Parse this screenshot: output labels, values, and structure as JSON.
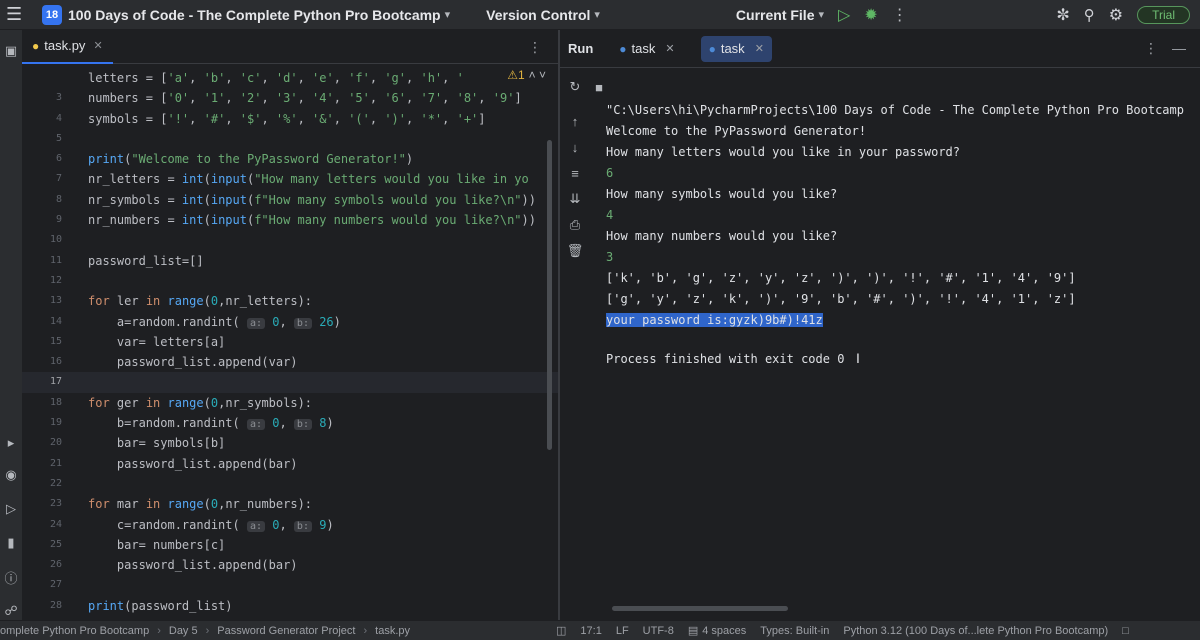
{
  "titlebar": {
    "project_badge": "18",
    "project_name": "100 Days of Code - The Complete Python Pro Bootcamp",
    "vcs_label": "Version Control",
    "run_config": "Current File",
    "trial_label": "Trial"
  },
  "editor": {
    "tab_label": "task.py",
    "warning_count": "1",
    "lines": [
      {
        "n": "",
        "html": "letters = [<span class=\"str\">'a'</span>, <span class=\"str\">'b'</span>, <span class=\"str\">'c'</span>, <span class=\"str\">'d'</span>, <span class=\"str\">'e'</span>, <span class=\"str\">'f'</span>, <span class=\"str\">'g'</span>, <span class=\"str\">'h'</span>, <span class=\"str\">'</span>"
      },
      {
        "n": "3",
        "html": "numbers = [<span class=\"str\">'0'</span>, <span class=\"str\">'1'</span>, <span class=\"str\">'2'</span>, <span class=\"str\">'3'</span>, <span class=\"str\">'4'</span>, <span class=\"str\">'5'</span>, <span class=\"str\">'6'</span>, <span class=\"str\">'7'</span>, <span class=\"str\">'8'</span>, <span class=\"str\">'9'</span>]"
      },
      {
        "n": "4",
        "html": "symbols = [<span class=\"str\">'!'</span>, <span class=\"str\">'#'</span>, <span class=\"str\">'$'</span>, <span class=\"str\">'%'</span>, <span class=\"str\">'&amp;'</span>, <span class=\"str\">'('</span>, <span class=\"str\">')'</span>, <span class=\"str\">'*'</span>, <span class=\"str\">'+'</span>]"
      },
      {
        "n": "5",
        "html": ""
      },
      {
        "n": "6",
        "html": "<span class=\"fn\">print</span>(<span class=\"str\">\"Welcome to the PyPassword Generator!\"</span>)"
      },
      {
        "n": "7",
        "html": "nr_letters = <span class=\"fn\">int</span>(<span class=\"fn\">input</span>(<span class=\"str\">\"How many letters would you like in yo</span>"
      },
      {
        "n": "8",
        "html": "nr_symbols = <span class=\"fn\">int</span>(<span class=\"fn\">input</span>(<span class=\"str\">f\"How many symbols would you like?\\n\"</span>))"
      },
      {
        "n": "9",
        "html": "nr_numbers = <span class=\"fn\">int</span>(<span class=\"fn\">input</span>(<span class=\"str\">f\"How many numbers would you like?\\n\"</span>))"
      },
      {
        "n": "10",
        "html": ""
      },
      {
        "n": "11",
        "html": "password_list=[]"
      },
      {
        "n": "12",
        "html": ""
      },
      {
        "n": "13",
        "html": "<span class=\"kw\">for</span> ler <span class=\"kw\">in</span> <span class=\"fn\">range</span>(<span class=\"num\">0</span>,nr_letters):"
      },
      {
        "n": "14",
        "html": "    a=random.randint( <span class=\"hint\">a:</span> <span class=\"num\">0</span>, <span class=\"hint\">b:</span> <span class=\"num\">26</span>)"
      },
      {
        "n": "15",
        "html": "    var= letters[a]"
      },
      {
        "n": "16",
        "html": "    password_list.append(var)"
      },
      {
        "n": "17",
        "html": "",
        "current": true
      },
      {
        "n": "18",
        "html": "<span class=\"kw\">for</span> ger <span class=\"kw\">in</span> <span class=\"fn\">range</span>(<span class=\"num\">0</span>,nr_symbols):"
      },
      {
        "n": "19",
        "html": "    b=random.randint( <span class=\"hint\">a:</span> <span class=\"num\">0</span>, <span class=\"hint\">b:</span> <span class=\"num\">8</span>)"
      },
      {
        "n": "20",
        "html": "    bar= symbols[b]"
      },
      {
        "n": "21",
        "html": "    password_list.append(bar)"
      },
      {
        "n": "22",
        "html": ""
      },
      {
        "n": "23",
        "html": "<span class=\"kw\">for</span> mar <span class=\"kw\">in</span> <span class=\"fn\">range</span>(<span class=\"num\">0</span>,nr_numbers):"
      },
      {
        "n": "24",
        "html": "    c=random.randint( <span class=\"hint\">a:</span> <span class=\"num\">0</span>, <span class=\"hint\">b:</span> <span class=\"num\">9</span>)"
      },
      {
        "n": "25",
        "html": "    bar= numbers[c]"
      },
      {
        "n": "26",
        "html": "    password_list.append(bar)"
      },
      {
        "n": "27",
        "html": ""
      },
      {
        "n": "28",
        "html": "<span class=\"fn\">print</span>(password_list)"
      }
    ]
  },
  "run": {
    "title": "Run",
    "tabs": [
      {
        "label": "task",
        "active": false
      },
      {
        "label": "task",
        "active": true
      }
    ],
    "console": [
      {
        "text": "\"C:\\Users\\hi\\PycharmProjects\\100 Days of Code - The Complete Python Pro Bootcamp",
        "kind": "out"
      },
      {
        "text": "Welcome to the PyPassword Generator!",
        "kind": "out"
      },
      {
        "text": "How many letters would you like in your password?",
        "kind": "out"
      },
      {
        "text": "6",
        "kind": "input"
      },
      {
        "text": "How many symbols would you like?",
        "kind": "out"
      },
      {
        "text": "4",
        "kind": "input"
      },
      {
        "text": "How many numbers would you like?",
        "kind": "out"
      },
      {
        "text": "3",
        "kind": "input"
      },
      {
        "text": "['k', 'b', 'g', 'z', 'y', 'z', ')', ')', '!', '#', '1', '4', '9']",
        "kind": "out"
      },
      {
        "text": "['g', 'y', 'z', 'k', ')', '9', 'b', '#', ')', '!', '4', '1', 'z']",
        "kind": "out"
      },
      {
        "text": "your password is:gyzk)9b#)!41z",
        "kind": "selected"
      },
      {
        "text": "",
        "kind": "blank"
      },
      {
        "text": "Process finished with exit code 0",
        "kind": "out"
      }
    ]
  },
  "status": {
    "breadcrumb": [
      "omplete Python Pro Bootcamp",
      "Day 5",
      "Password Generator Project",
      "task.py"
    ],
    "position": "17:1",
    "line_sep": "LF",
    "encoding": "UTF-8",
    "indent": "4 spaces",
    "types": "Types: Built-in",
    "interpreter": "Python 3.12 (100 Days of...lete Python Pro Bootcamp)"
  },
  "colors": {
    "background": "#1e1f22",
    "panel": "#2b2d30",
    "accent": "#3574f0",
    "selection": "#2f65ca",
    "run_green": "#5fb865"
  }
}
